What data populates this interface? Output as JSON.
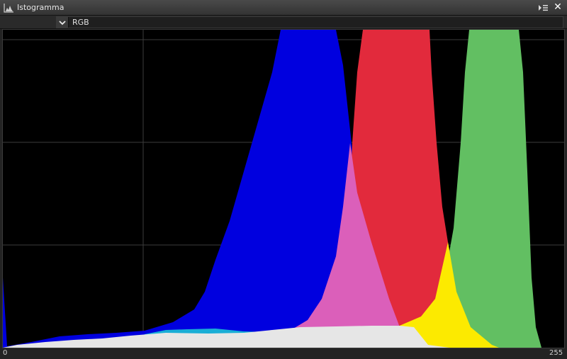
{
  "window": {
    "title": "Istogramma",
    "icon": "histogram-icon",
    "menu_icon": "panel-menu-icon",
    "close_label": "✕"
  },
  "toolbar": {
    "mode_select": {
      "value": "RGB"
    }
  },
  "histogram": {
    "scale_min": "0",
    "scale_max": "255",
    "grid": true,
    "colors": {
      "red": "#e22a3c",
      "green": "#62bf62",
      "blue": "#0000df",
      "red_blue_overlap": "#db5fba",
      "red_green_overlap": "#fcea00",
      "green_blue_overlap": "#1aaed6",
      "all_overlap": "#e6e6e6",
      "grid": "#3c3c3c"
    }
  }
}
